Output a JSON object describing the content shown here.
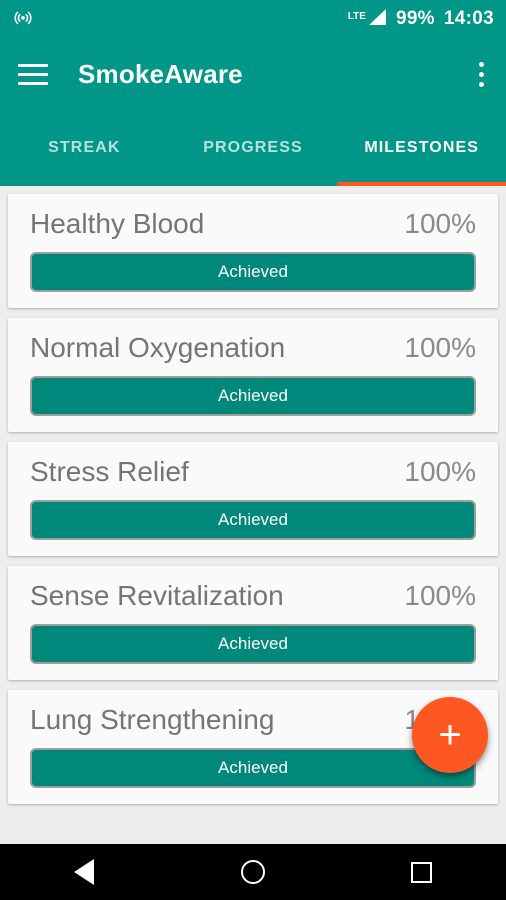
{
  "status_bar": {
    "cast_icon": "cast-hotspot-icon",
    "network_label": "LTE",
    "signal_icon": "signal-triangle-icon",
    "battery": "99%",
    "time": "14:03"
  },
  "app_bar": {
    "menu_icon": "hamburger-menu-icon",
    "title": "SmokeAware",
    "overflow_icon": "overflow-menu-icon"
  },
  "tabs": {
    "items": [
      {
        "label": "STREAK",
        "active": false
      },
      {
        "label": "PROGRESS",
        "active": false
      },
      {
        "label": "MILESTONES",
        "active": true
      }
    ],
    "indicator_color": "#ff5722"
  },
  "milestones": [
    {
      "title": "Healthy Blood",
      "percent": "100%",
      "status": "Achieved"
    },
    {
      "title": "Normal Oxygenation",
      "percent": "100%",
      "status": "Achieved"
    },
    {
      "title": "Stress Relief",
      "percent": "100%",
      "status": "Achieved"
    },
    {
      "title": "Sense Revitalization",
      "percent": "100%",
      "status": "Achieved"
    },
    {
      "title": "Lung Strengthening",
      "percent": "100%",
      "status": "Achieved"
    }
  ],
  "fab": {
    "label": "+",
    "color": "#ff5722"
  },
  "nav_bar": {
    "back": "back-icon",
    "home": "home-icon",
    "recents": "recents-icon"
  },
  "theme": {
    "primary": "#009688",
    "accent": "#ff5722",
    "progress_fill": "#00897b",
    "background": "#eeeeee",
    "card": "#fafafa",
    "text": "#757575"
  }
}
